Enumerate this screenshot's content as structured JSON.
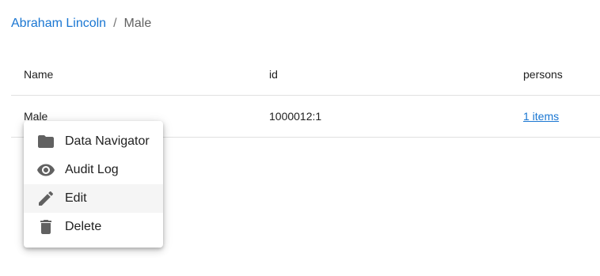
{
  "breadcrumb": {
    "parent": "Abraham Lincoln",
    "separator": "/",
    "current": "Male"
  },
  "table": {
    "columns": [
      "Name",
      "id",
      "persons"
    ],
    "rows": [
      {
        "name": "Male",
        "id": "1000012:1",
        "persons": "1 items"
      }
    ]
  },
  "context_menu": {
    "items": [
      {
        "label": "Data Navigator",
        "icon": "folder-icon"
      },
      {
        "label": "Audit Log",
        "icon": "eye-icon"
      },
      {
        "label": "Edit",
        "icon": "pencil-icon",
        "highlighted": true
      },
      {
        "label": "Delete",
        "icon": "trash-icon"
      }
    ]
  },
  "colors": {
    "link": "#1976d2",
    "icon": "#616161",
    "highlight": "#f5f5f5"
  }
}
